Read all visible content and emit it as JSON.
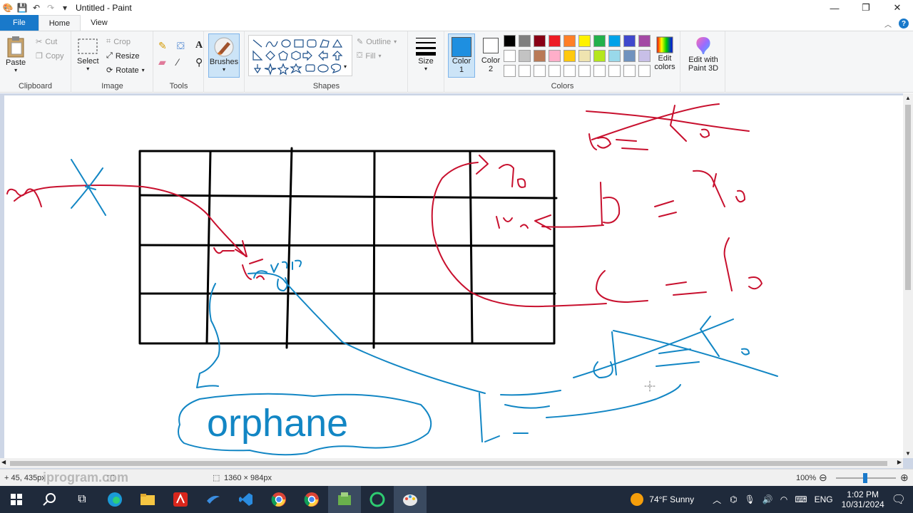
{
  "window": {
    "title": "Untitled - Paint",
    "minimize_glyph": "—",
    "restore_glyph": "❐",
    "close_glyph": "✕"
  },
  "tabs": [
    "File",
    "Home",
    "View"
  ],
  "ribbon": {
    "clipboard": {
      "label": "Clipboard",
      "paste": "Paste",
      "cut": "Cut",
      "copy": "Copy"
    },
    "image": {
      "label": "Image",
      "select": "Select",
      "crop": "Crop",
      "resize": "Resize",
      "rotate": "Rotate"
    },
    "tools": {
      "label": "Tools"
    },
    "brushes": {
      "label": "Brushes"
    },
    "shapes": {
      "label": "Shapes",
      "outline": "Outline",
      "fill": "Fill"
    },
    "size": {
      "label": "Size"
    },
    "colors": {
      "label": "Colors",
      "color1": "Color 1",
      "color2": "Color 2",
      "color1_value": "#1e8fe0",
      "color2_value": "#ffffff",
      "edit_colors": "Edit colors",
      "edit_3d": "Edit with Paint 3D",
      "palette_row1": [
        "#000000",
        "#7f7f7f",
        "#880015",
        "#ed1c24",
        "#ff7f27",
        "#fff200",
        "#22b14c",
        "#00a2e8",
        "#3f48cc",
        "#a349a4"
      ],
      "palette_row2": [
        "#ffffff",
        "#c3c3c3",
        "#b97a57",
        "#ffaec9",
        "#ffc90e",
        "#efe4b0",
        "#b5e61d",
        "#99d9ea",
        "#7092be",
        "#c8bfe7"
      ],
      "palette_row3": [
        "#ffffff",
        "#ffffff",
        "#ffffff",
        "#ffffff",
        "#ffffff",
        "#ffffff",
        "#ffffff",
        "#ffffff",
        "#ffffff",
        "#ffffff"
      ]
    }
  },
  "canvas": {
    "handwritten_text": "orphane"
  },
  "status": {
    "cursor_pos": "+ 45, 435px",
    "watermark": "iprogram.com",
    "canvas_size": "1360 × 984px",
    "zoom": "100%"
  },
  "taskbar": {
    "weather": "74°F  Sunny",
    "language": "ENG",
    "time": "1:02 PM",
    "date": "10/31/2024"
  }
}
